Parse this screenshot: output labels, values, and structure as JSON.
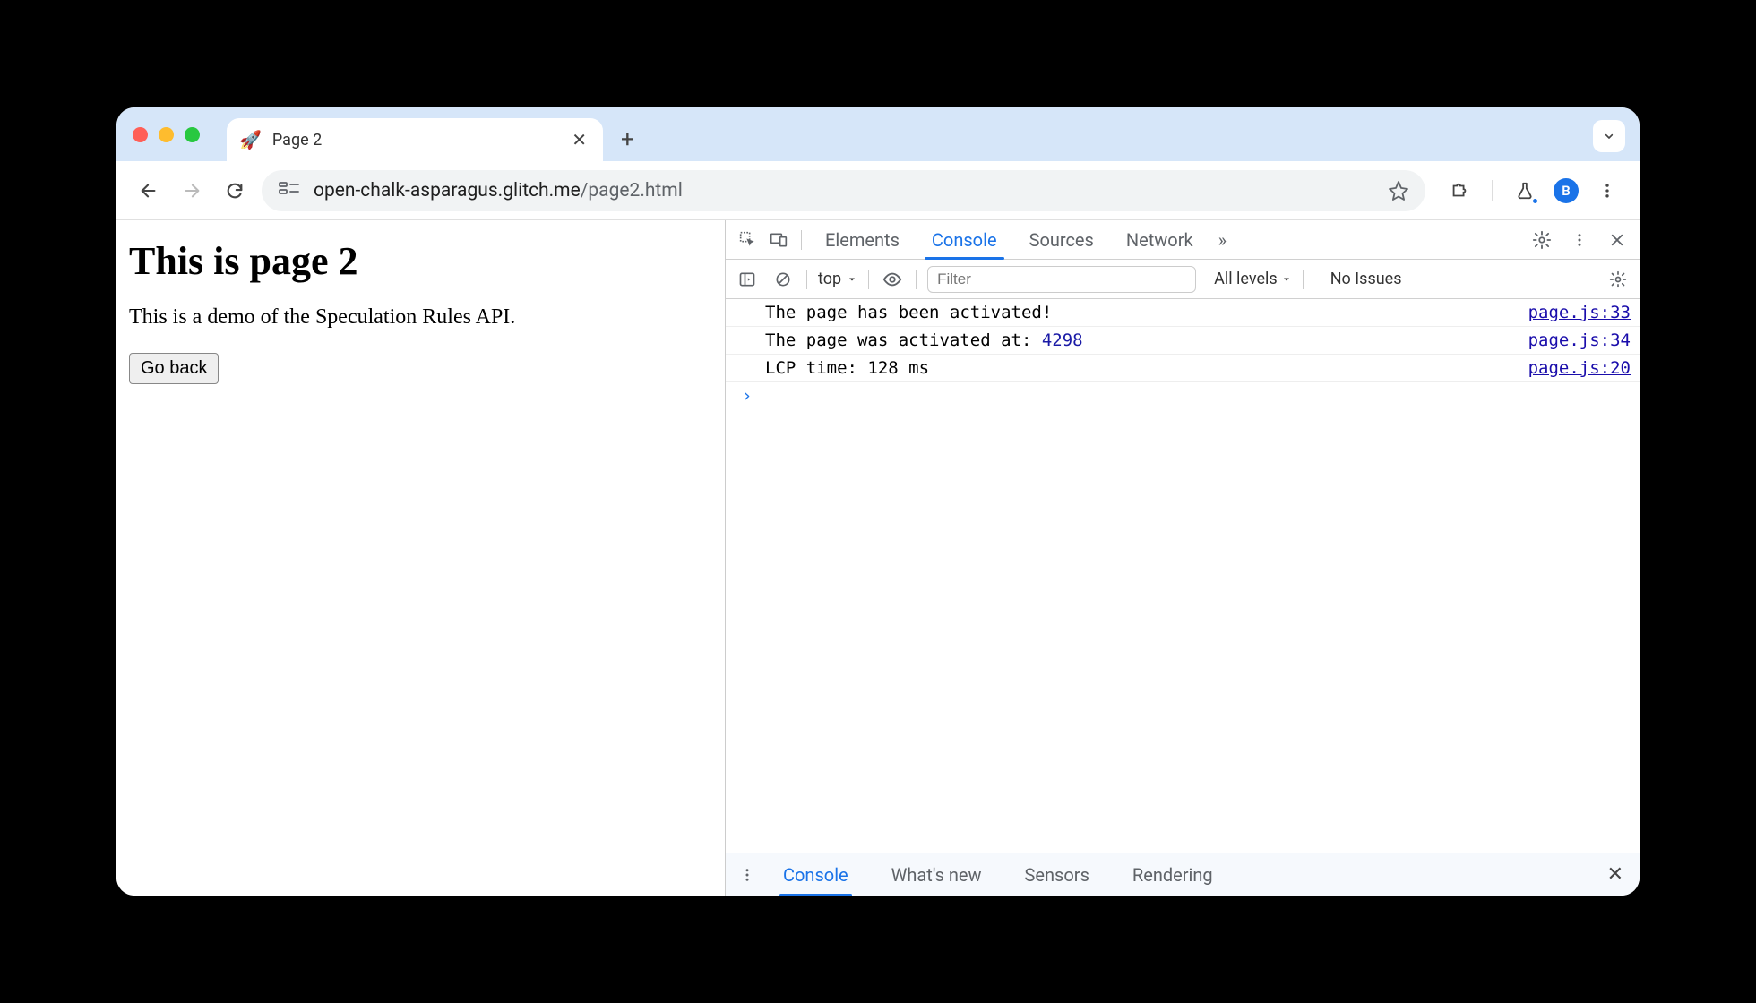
{
  "tab": {
    "icon": "🚀",
    "title": "Page 2"
  },
  "address": {
    "domain": "open-chalk-asparagus.glitch.me",
    "path": "/page2.html"
  },
  "avatar_letter": "B",
  "page": {
    "heading": "This is page 2",
    "description": "This is a demo of the Speculation Rules API.",
    "back_button": "Go back"
  },
  "devtools": {
    "tabs": [
      "Elements",
      "Console",
      "Sources",
      "Network"
    ],
    "active_tab": "Console",
    "more_symbol": "»",
    "console_toolbar": {
      "context": "top",
      "filter_placeholder": "Filter",
      "levels": "All levels",
      "issues": "No Issues"
    },
    "logs": [
      {
        "msg_a": "The page has been activated!",
        "msg_b": "",
        "src": "page.js:33"
      },
      {
        "msg_a": "The page was activated at: ",
        "msg_b": "4298",
        "src": "page.js:34"
      },
      {
        "msg_a": "LCP time: 128 ms",
        "msg_b": "",
        "src": "page.js:20"
      }
    ],
    "prompt": "›",
    "drawer_tabs": [
      "Console",
      "What's new",
      "Sensors",
      "Rendering"
    ],
    "drawer_active": "Console"
  }
}
